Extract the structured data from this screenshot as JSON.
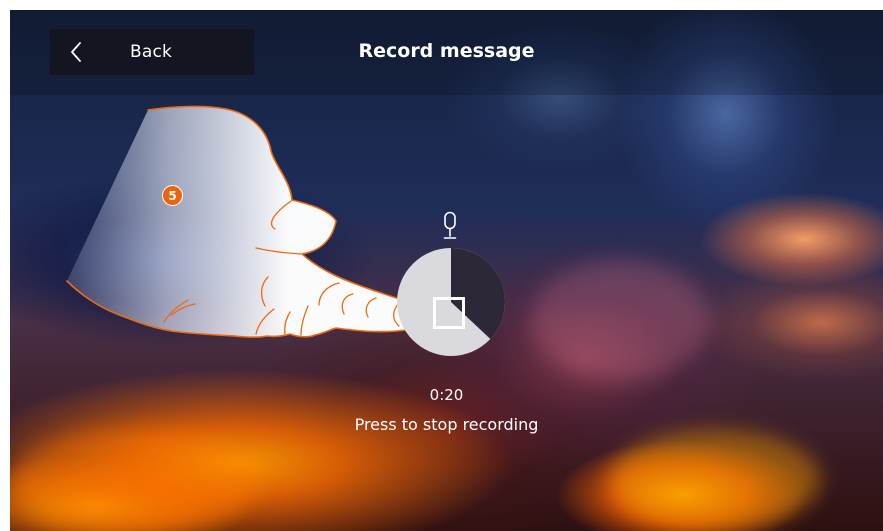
{
  "header": {
    "back_label": "Back",
    "title": "Record message"
  },
  "recording": {
    "timer": "0:20",
    "instruction": "Press to stop recording",
    "progress_fraction": 0.37
  },
  "annotation": {
    "step": "5"
  },
  "icons": {
    "back": "chevron-left-icon",
    "microphone": "microphone-icon",
    "stop": "stop-icon"
  },
  "colors": {
    "badge": "#ea650d",
    "progress_remaining": "#d9d9de",
    "progress_elapsed": "#2d2838"
  }
}
